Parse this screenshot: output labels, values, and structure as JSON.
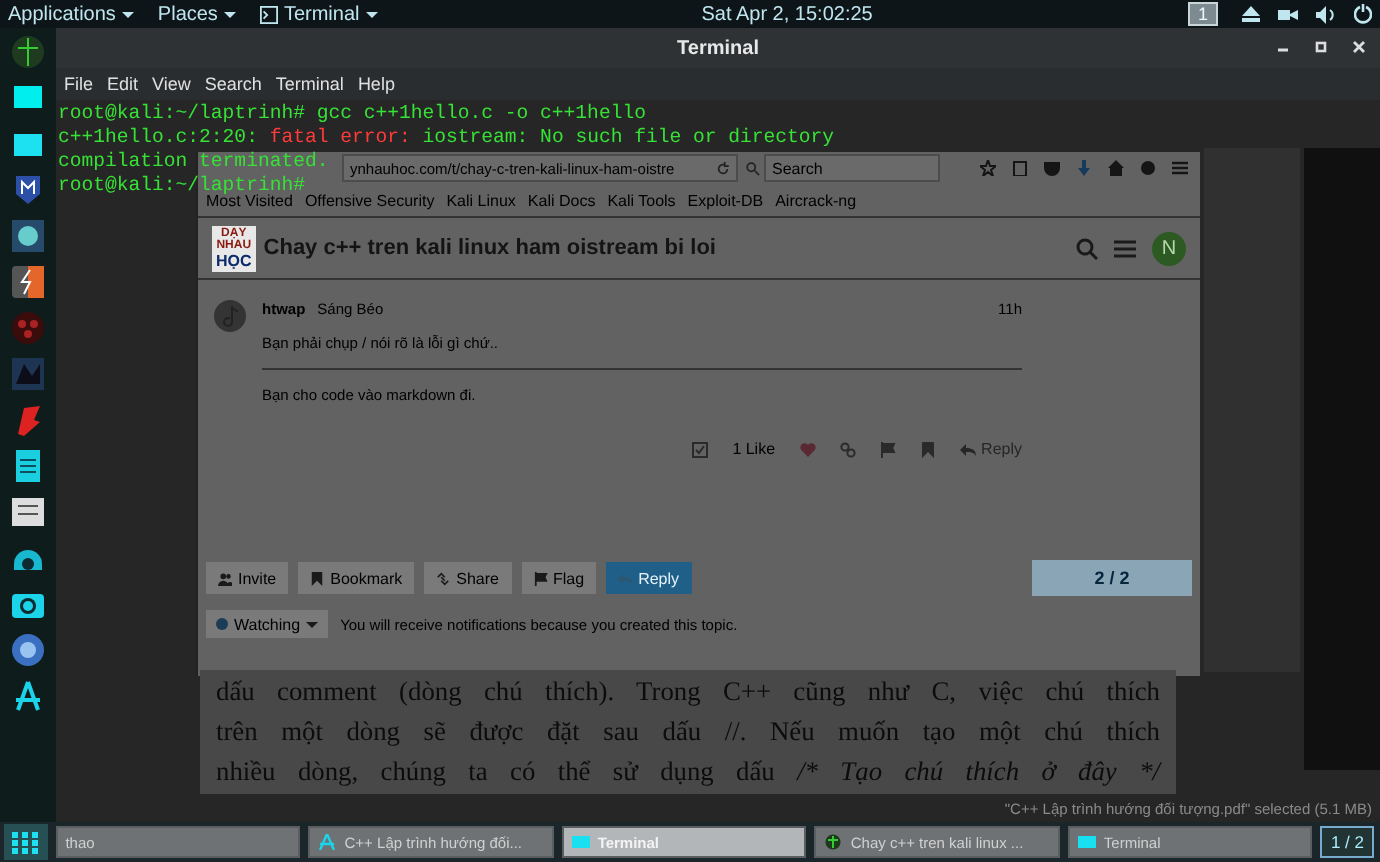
{
  "top_bar": {
    "menus": [
      {
        "label": "Applications",
        "kind": "menu"
      },
      {
        "label": "Places",
        "kind": "menu"
      },
      {
        "label": "Terminal",
        "kind": "app"
      }
    ],
    "clock": "Sat Apr  2, 15:02:25",
    "workspace": "1"
  },
  "terminal": {
    "title": "Terminal",
    "menu": [
      "File",
      "Edit",
      "View",
      "Search",
      "Terminal",
      "Help"
    ],
    "lines": [
      [
        {
          "text": "root@kali:~/laptrinh# gcc c++1hello.c -o c++1hello",
          "kind": "normal"
        }
      ],
      [
        {
          "text": "c++1hello.c:2:20: ",
          "kind": "normal"
        },
        {
          "text": "fatal error:",
          "kind": "error"
        },
        {
          "text": " iostream: No such file or directory",
          "kind": "normal"
        }
      ],
      [
        {
          "text": "compilation terminated.",
          "kind": "normal"
        }
      ],
      [
        {
          "text": "root@kali:~/laptrinh#",
          "kind": "normal"
        }
      ]
    ]
  },
  "browser": {
    "url": "ynhauhoc.com/t/chay-c-tren-kali-linux-ham-oistre",
    "search_placeholder": "Search",
    "bookmarks": [
      "Most Visited",
      "Offensive Security",
      "Kali Linux",
      "Kali Docs",
      "Kali Tools",
      "Exploit-DB",
      "Aircrack-ng"
    ],
    "logo": [
      "DẠY",
      "NHAU",
      "HỌC"
    ],
    "topic_title": "Chay c++ tren kali linux ham oistream bi loi",
    "user_avatar": "N",
    "post": {
      "author": "htwap",
      "name": "Sáng Béo",
      "time": "11h",
      "paragraphs": [
        "Bạn phải chụp / nói rõ là lỗi gì chứ..",
        "Bạn cho code vào markdown đi."
      ],
      "likes": "1 Like",
      "reply": "Reply"
    },
    "footer_buttons": [
      {
        "label": "Invite",
        "kind": "invite"
      },
      {
        "label": "Bookmark",
        "kind": "bookmark"
      },
      {
        "label": "Share",
        "kind": "share"
      },
      {
        "label": "Flag",
        "kind": "flag"
      },
      {
        "label": "Reply",
        "kind": "reply"
      }
    ],
    "progress": "2 / 2",
    "notification": {
      "level": "Watching",
      "text": "You will receive notifications because you created this topic."
    }
  },
  "pdf": {
    "lines": [
      [
        {
          "text": "dấu comment (dòng chú thích). Trong C++ cũng như C, việc chú thích",
          "kind": "plain"
        }
      ],
      [
        {
          "text": "trên một dòng sẽ được đặt sau dấu //. Nếu muốn tạo một chú thích",
          "kind": "plain"
        }
      ],
      [
        {
          "text": "nhiều dòng, chúng ta có thể sử dụng dấu ",
          "kind": "plain"
        },
        {
          "text": "/* Tạo chú thích ở đây */",
          "kind": "italic"
        }
      ]
    ]
  },
  "file_status": "\"C++ Lập trình hướng đối tượng.pdf\" selected (5.1 MB)",
  "taskbar": {
    "items": [
      {
        "label": "thao",
        "kind": "plain",
        "selected": false
      },
      {
        "label": "C++ Lập trình hướng đối...",
        "kind": "pdf",
        "selected": false
      },
      {
        "label": "Terminal",
        "kind": "terminal",
        "selected": true
      },
      {
        "label": "Chay c++ tren kali linux ...",
        "kind": "browser",
        "selected": false
      },
      {
        "label": "Terminal",
        "kind": "terminal",
        "selected": false
      }
    ],
    "pager": "1 / 2"
  }
}
